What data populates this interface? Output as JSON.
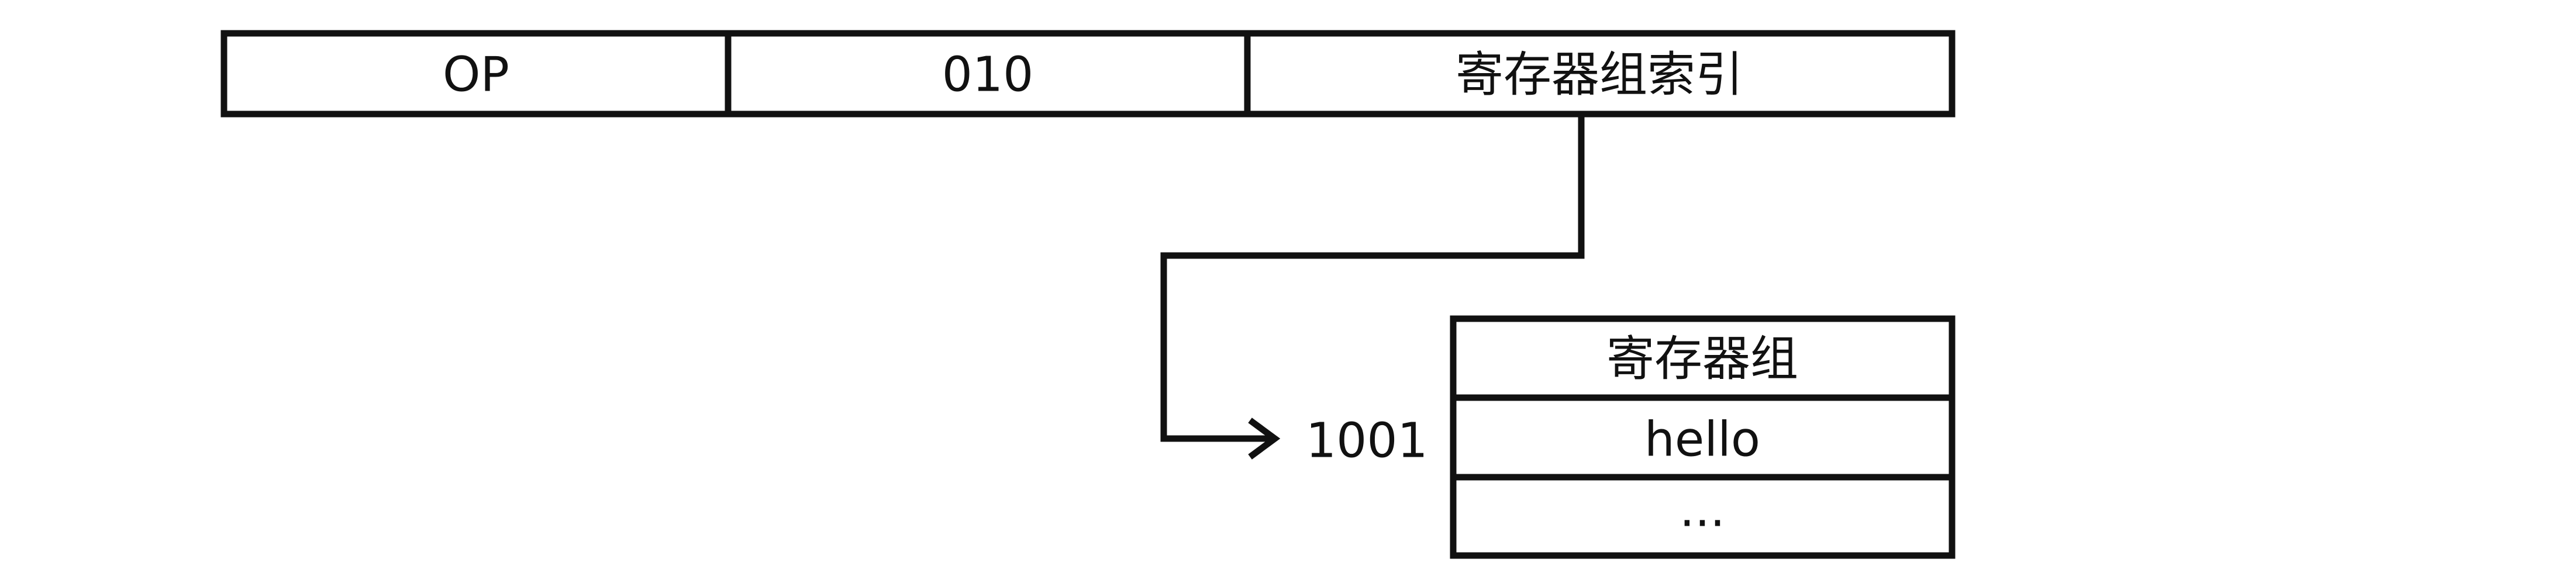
{
  "instruction": {
    "fields": [
      {
        "label": "OP"
      },
      {
        "label": "010"
      },
      {
        "label": "寄存器组索引"
      }
    ]
  },
  "pointer": {
    "address_label": "1001"
  },
  "register_group": {
    "title": "寄存器组",
    "rows": [
      {
        "label": "hello"
      },
      {
        "label": "..."
      }
    ]
  },
  "colors": {
    "stroke": "#111111",
    "background": "#ffffff"
  }
}
